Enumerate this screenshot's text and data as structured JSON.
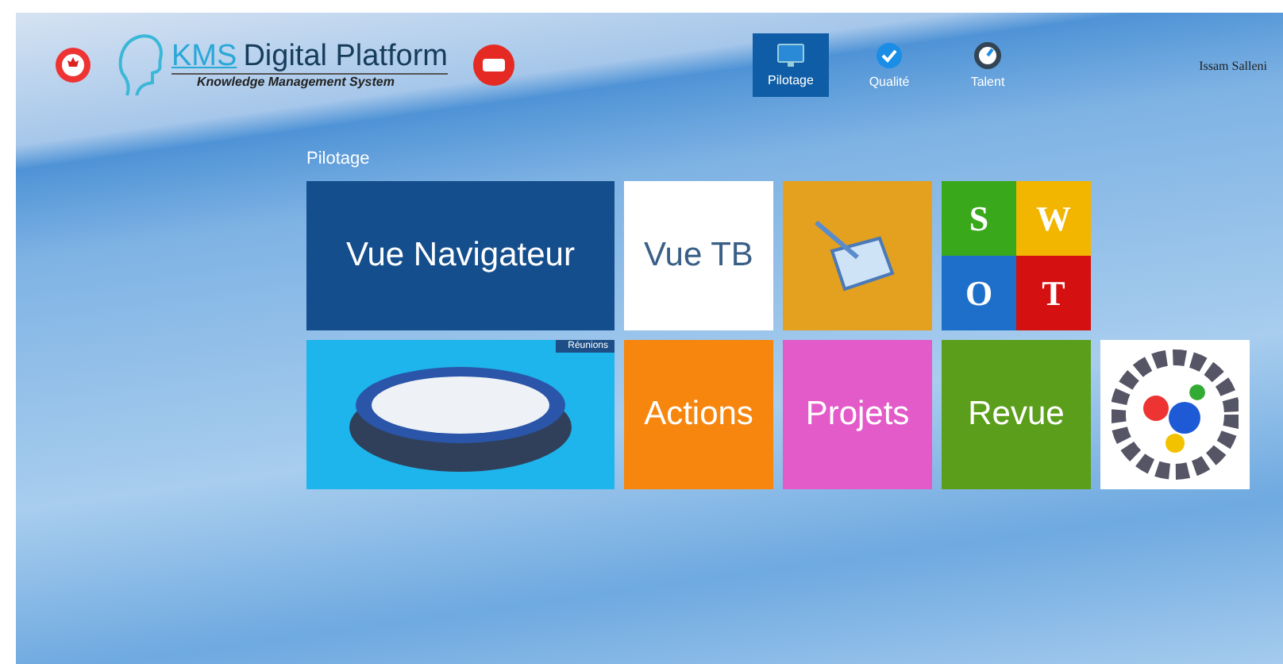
{
  "header": {
    "logo_title": "KMS",
    "logo_subtitle": "Digital Platform",
    "logo_tagline": "Knowledge Management System",
    "user_name": "Issam Salleni"
  },
  "nav_tabs": [
    {
      "label": "Pilotage",
      "selected": true
    },
    {
      "label": "Qualité",
      "selected": false
    },
    {
      "label": "Talent",
      "selected": false
    }
  ],
  "section_title": "Pilotage",
  "tiles": [
    {
      "kind": "text",
      "label": "Vue Navigateur",
      "color": "#154e8c",
      "wide": true
    },
    {
      "kind": "text",
      "label": "Vue TB",
      "color": "#ffffff",
      "wide": false
    },
    {
      "kind": "tablet",
      "color": "#e3a11f",
      "wide": false
    },
    {
      "kind": "swot",
      "letters": [
        "S",
        "W",
        "O",
        "T"
      ],
      "wide": false
    },
    {
      "kind": "meeting",
      "badge": "Réunions",
      "color": "#1eb4ec",
      "wide": true
    },
    {
      "kind": "text",
      "label": "Actions",
      "color": "#f7860f",
      "wide": false
    },
    {
      "kind": "text",
      "label": "Projets",
      "color": "#e35ac9",
      "wide": false
    },
    {
      "kind": "text",
      "label": "Revue",
      "color": "#5a9e1b",
      "wide": false
    },
    {
      "kind": "gears",
      "color": "#ffffff",
      "wide": false
    }
  ]
}
